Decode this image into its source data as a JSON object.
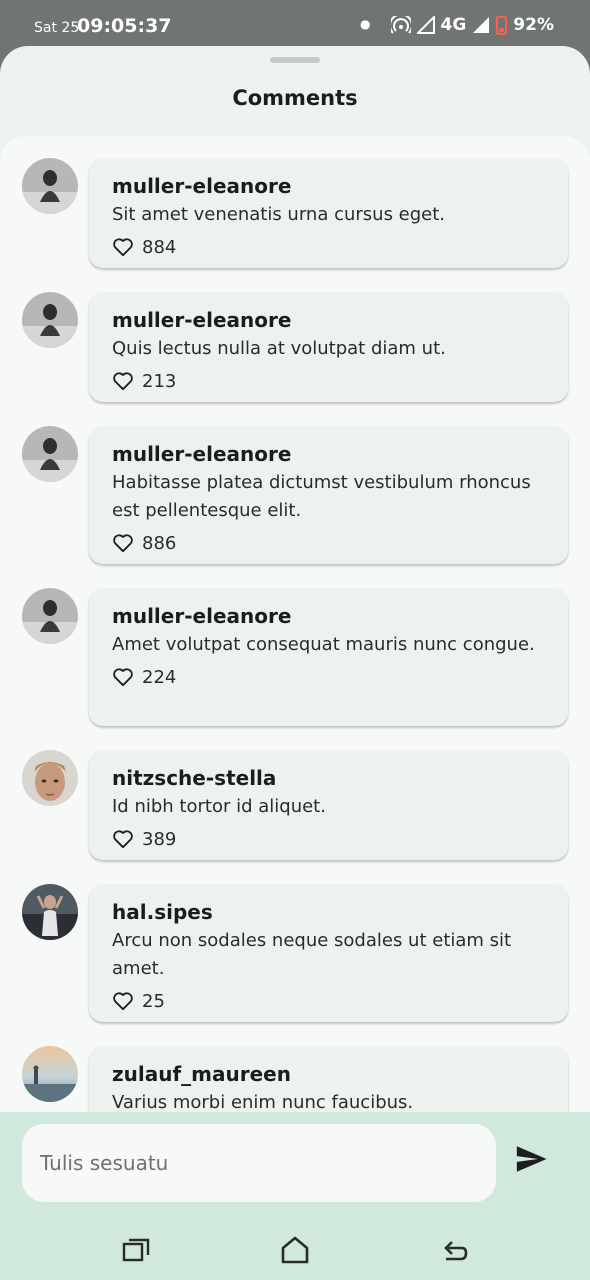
{
  "status_bar": {
    "date": "Sat 25",
    "time": "09:05:37",
    "network": "4G",
    "battery": "92%"
  },
  "sheet": {
    "title": "Comments"
  },
  "comments": [
    {
      "user": "muller-eleanore",
      "text": "Sit amet venenatis urna cursus eget.",
      "likes": "884",
      "avatar": "bw-sitting-figure"
    },
    {
      "user": "muller-eleanore",
      "text": "Quis lectus nulla at volutpat diam ut.",
      "likes": "213",
      "avatar": "bw-sitting-figure"
    },
    {
      "user": "muller-eleanore",
      "text": "Habitasse platea dictumst vestibulum rhoncus est pellentesque elit.",
      "likes": "886",
      "avatar": "bw-sitting-figure"
    },
    {
      "user": "muller-eleanore",
      "text": "Amet volutpat consequat mauris nunc congue.",
      "likes": "224",
      "avatar": "bw-sitting-figure"
    },
    {
      "user": "nitzsche-stella",
      "text": "Id nibh tortor id aliquet.",
      "likes": "389",
      "avatar": "male-face"
    },
    {
      "user": "hal.sipes",
      "text": "Arcu non sodales neque sodales ut etiam sit amet.",
      "likes": "25",
      "avatar": "woman-by-car"
    },
    {
      "user": "zulauf_maureen",
      "text": "Varius morbi enim nunc faucibus.",
      "likes": "",
      "avatar": "person-on-beach"
    }
  ],
  "composer": {
    "placeholder": "Tulis sesuatu"
  },
  "icons": {
    "like": "heart-outline-icon",
    "send": "send-icon",
    "nav_recents": "recents-icon",
    "nav_home": "home-icon",
    "nav_back": "back-icon"
  },
  "colors": {
    "sheet_bg": "#eef2ef",
    "bubble_bg": "#edf2ef",
    "composer_bg": "#d0e9dc",
    "status_bar_bg": "#707472"
  }
}
